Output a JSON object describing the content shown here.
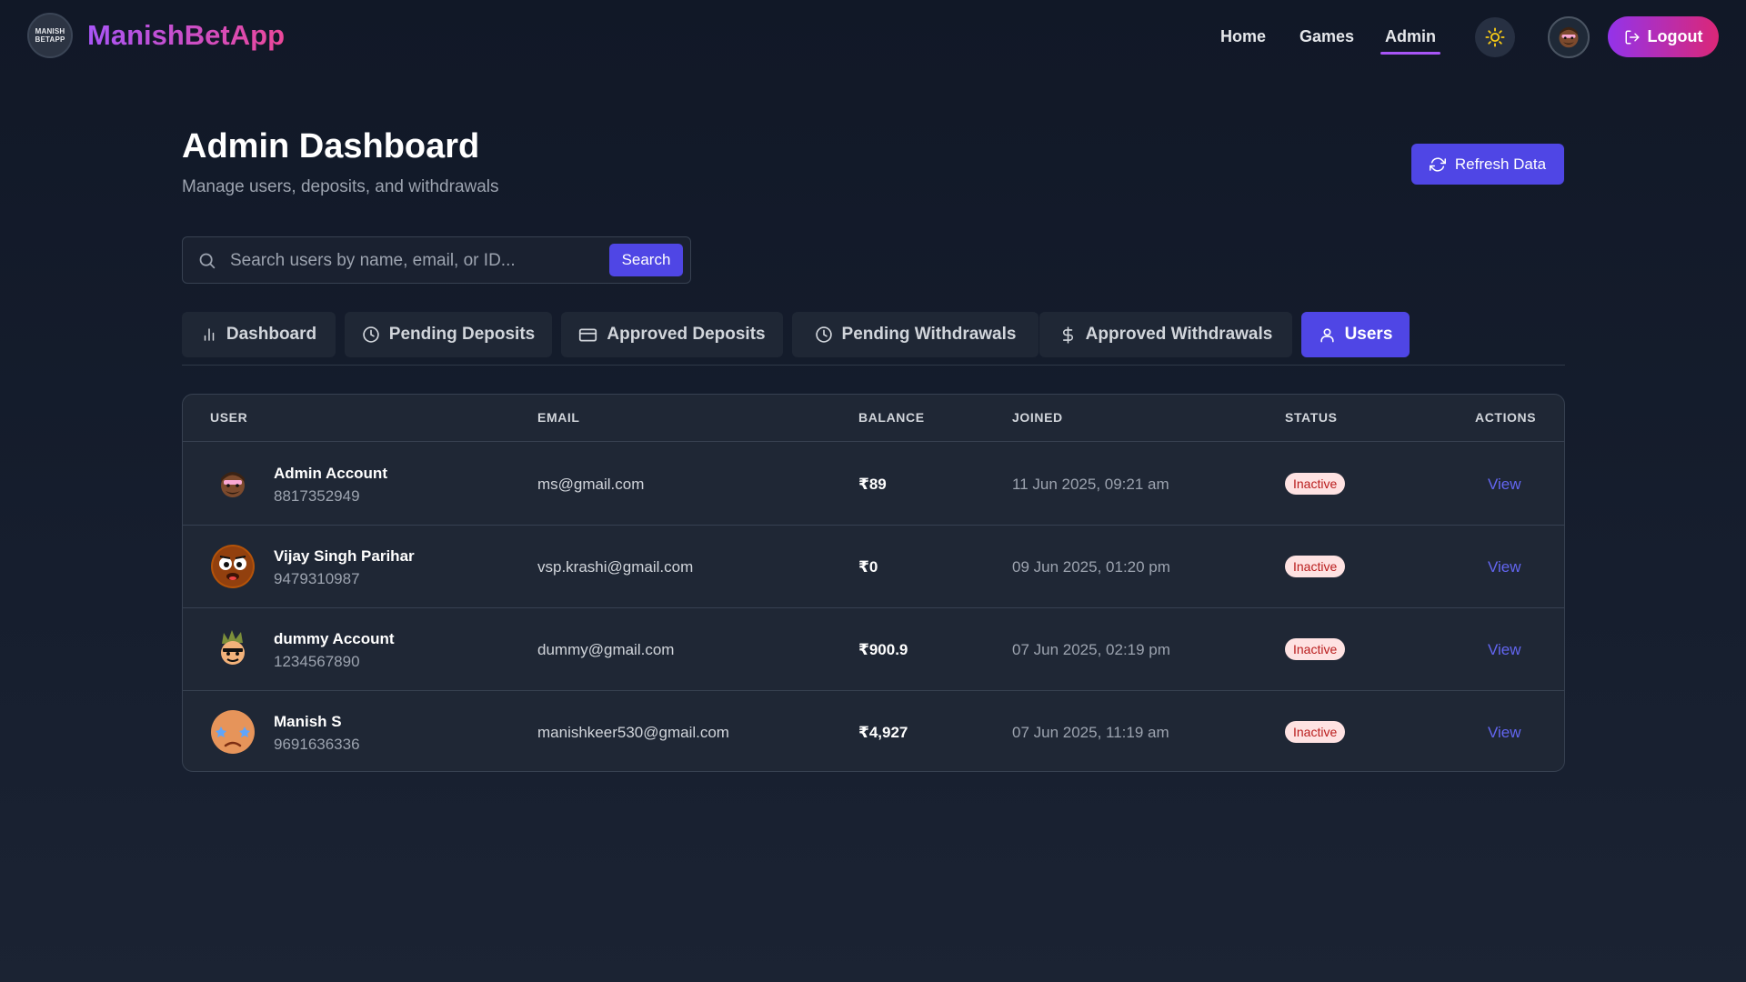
{
  "header": {
    "logo_line1": "MANISH",
    "logo_line2": "BETAPP",
    "brand": "ManishBetApp",
    "nav": [
      {
        "label": "Home",
        "active": false
      },
      {
        "label": "Games",
        "active": false
      },
      {
        "label": "Admin",
        "active": true
      }
    ],
    "theme_icon": "sun-icon",
    "logout_label": "Logout"
  },
  "page": {
    "title": "Admin Dashboard",
    "subtitle": "Manage users, deposits, and withdrawals",
    "refresh_label": "Refresh Data"
  },
  "search": {
    "placeholder": "Search users by name, email, or ID...",
    "value": "",
    "button_label": "Search"
  },
  "tabs": [
    {
      "label": "Dashboard",
      "icon": "bar-chart-icon",
      "active": false
    },
    {
      "label": "Pending Deposits",
      "icon": "clock-icon",
      "active": false
    },
    {
      "label": "Approved Deposits",
      "icon": "credit-card-icon",
      "active": false
    },
    {
      "label": "Pending Withdrawals",
      "icon": "clock-icon",
      "active": false
    },
    {
      "label": "Approved Withdrawals",
      "icon": "dollar-icon",
      "active": false
    },
    {
      "label": "Users",
      "icon": "user-icon",
      "active": true
    }
  ],
  "table": {
    "columns": [
      "USER",
      "EMAIL",
      "BALANCE",
      "JOINED",
      "STATUS",
      "ACTIONS"
    ],
    "rows": [
      {
        "name": "Admin Account",
        "phone": "8817352949",
        "email": "ms@gmail.com",
        "balance": "₹89",
        "joined": "11 Jun 2025, 09:21 am",
        "status": "Inactive",
        "action": "View",
        "avatar": "bearded-man-emoji"
      },
      {
        "name": "Vijay Singh Parihar",
        "phone": "9479310987",
        "email": "vsp.krashi@gmail.com",
        "balance": "₹0",
        "joined": "09 Jun 2025, 01:20 pm",
        "status": "Inactive",
        "action": "View",
        "avatar": "surprised-face-emoji"
      },
      {
        "name": "dummy Account",
        "phone": "1234567890",
        "email": "dummy@gmail.com",
        "balance": "₹900.9",
        "joined": "07 Jun 2025, 02:19 pm",
        "status": "Inactive",
        "action": "View",
        "avatar": "spiky-hair-man-emoji"
      },
      {
        "name": "Manish S",
        "phone": "9691636336",
        "email": "manishkeer530@gmail.com",
        "balance": "₹4,927",
        "joined": "07 Jun 2025, 11:19 am",
        "status": "Inactive",
        "action": "View",
        "avatar": "star-eyes-face-emoji"
      }
    ]
  },
  "colors": {
    "accent": "#4f46e5",
    "brand_gradient_start": "#a855f7",
    "brand_gradient_end": "#ec4899",
    "status_inactive_bg": "#fee2e2",
    "status_inactive_text": "#b91c1c",
    "link": "#6366f1"
  }
}
